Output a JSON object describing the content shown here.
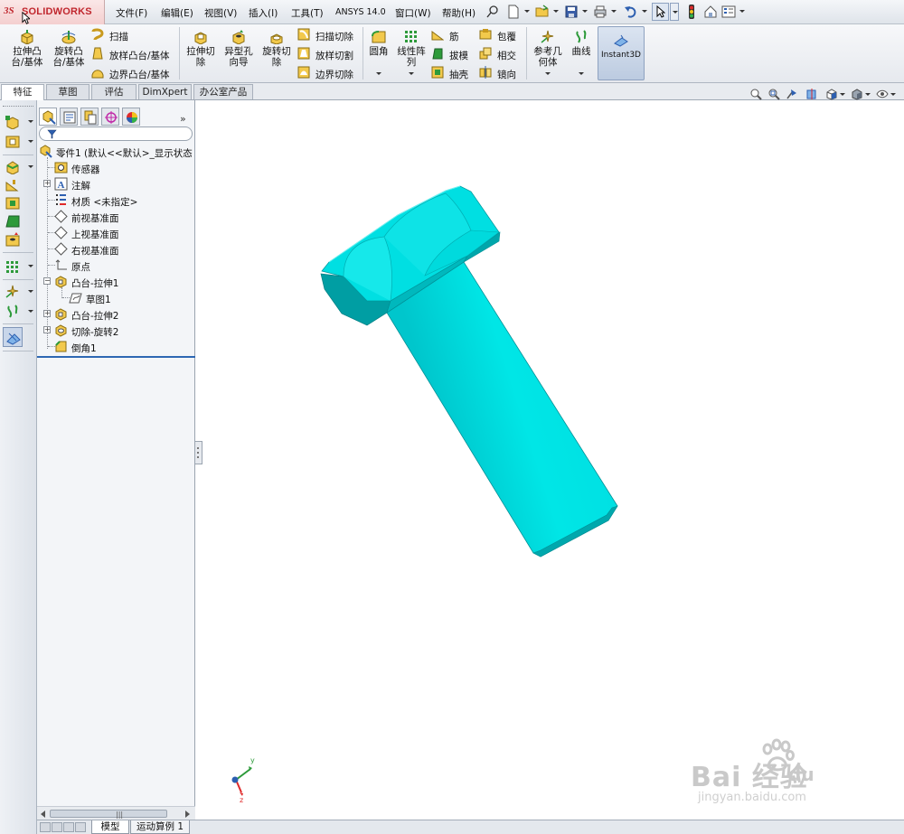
{
  "app": {
    "logo_ds": "3S",
    "logo_name": "SOLIDWORKS"
  },
  "menubar": {
    "items": [
      "文件(F)",
      "编辑(E)",
      "视图(V)",
      "插入(I)",
      "工具(T)",
      "ANSYS 14.0",
      "窗口(W)",
      "帮助(H)"
    ]
  },
  "ribbon": {
    "extrude_boss": "拉伸凸\n台/基体",
    "revolve_boss": "旋转凸\n台/基体",
    "sweep": "扫描",
    "loft_boss": "放样凸台/基体",
    "boundary_boss": "边界凸台/基体",
    "extrude_cut": "拉伸切\n除",
    "hole_wizard": "异型孔\n向导",
    "revolve_cut": "旋转切\n除",
    "swept_cut": "扫描切除",
    "lofted_cut": "放样切割",
    "boundary_cut": "边界切除",
    "fillet": "圆角",
    "linear_pattern": "线性阵\n列",
    "rib": "筋",
    "draft": "拔模",
    "shell": "抽壳",
    "wrap": "包覆",
    "intersect": "相交",
    "mirror": "镜向",
    "ref_geometry": "参考几\n何体",
    "curves": "曲线",
    "instant3d": "Instant3D"
  },
  "tabs": [
    "特征",
    "草图",
    "评估",
    "DimXpert",
    "办公室产品"
  ],
  "active_tab": "特征",
  "feature_tree": {
    "root": "零件1  (默认<<默认>_显示状态",
    "nodes": [
      {
        "label": "传感器",
        "icon": "sensor-icon"
      },
      {
        "label": "注解",
        "icon": "annotation-icon"
      },
      {
        "label": "材质 <未指定>",
        "icon": "material-icon"
      },
      {
        "label": "前视基准面",
        "icon": "plane-icon"
      },
      {
        "label": "上视基准面",
        "icon": "plane-icon"
      },
      {
        "label": "右视基准面",
        "icon": "plane-icon"
      },
      {
        "label": "原点",
        "icon": "origin-icon"
      },
      {
        "label": "凸台-拉伸1",
        "icon": "boss-extrude-icon"
      },
      {
        "label": "草图1",
        "icon": "sketch-icon"
      },
      {
        "label": "凸台-拉伸2",
        "icon": "boss-extrude-icon"
      },
      {
        "label": "切除-旋转2",
        "icon": "cut-revolve-icon"
      },
      {
        "label": "倒角1",
        "icon": "chamfer-icon"
      }
    ]
  },
  "bottom_tabs": [
    "模型",
    "运动算例 1"
  ],
  "active_bottom_tab": "模型",
  "triad": {
    "y": "y",
    "z": "z"
  },
  "watermark": {
    "brand": "Bai  经验",
    "du": "du",
    "url": "jingyan.baidu.com"
  },
  "colors": {
    "model": "#00d9dc",
    "logo_red": "#c0262d",
    "rollback_bar": "#2d67b3"
  }
}
